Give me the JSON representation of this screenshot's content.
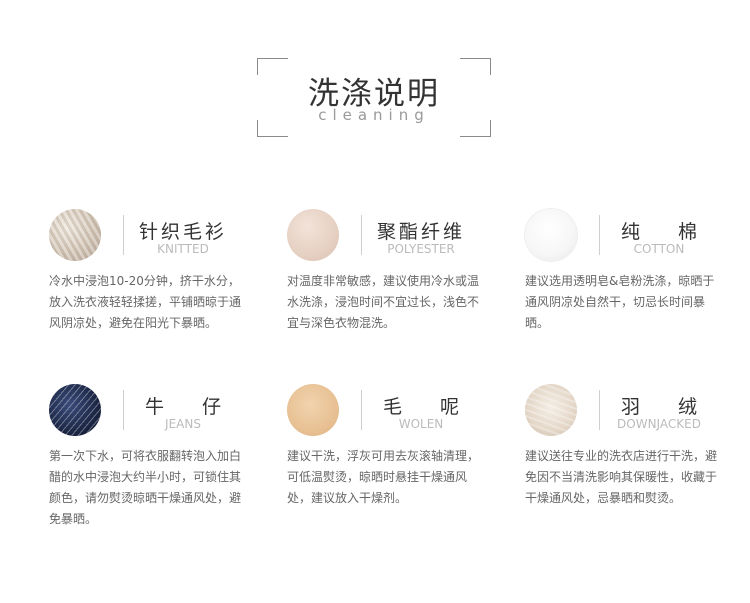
{
  "header": {
    "title": "洗涤说明",
    "subtitle": "cleaning"
  },
  "colors": {
    "title": "#333333",
    "text": "#666666",
    "english": "#bbbbbb",
    "corner": "#8a8a8a"
  },
  "fabrics": [
    {
      "name": "针织毛衫",
      "english": "KNITTED",
      "swatch": "knitted-swatch",
      "description": "冷水中浸泡10-20分钟，挤干水分，放入洗衣液轻轻揉搓，平铺晒晾于通风阴凉处，避免在阳光下暴晒。"
    },
    {
      "name": "聚酯纤维",
      "english": "POLYESTER",
      "swatch": "polyester-swatch",
      "description": "对温度非常敏感，建议使用冷水或温水洗涤，浸泡时间不宜过长，浅色不宜与深色衣物混洗。"
    },
    {
      "name": "纯　　棉",
      "english": "COTTON",
      "swatch": "cotton-swatch",
      "description": "建议选用透明皂&皂粉洗涤，晾晒于通风阴凉处自然干，切忌长时间暴晒。"
    },
    {
      "name": "牛　　仔",
      "english": "JEANS",
      "swatch": "jeans-swatch",
      "description": "第一次下水，可将衣服翻转泡入加白醋的水中浸泡大约半小时，可锁住其颜色，请勿熨烫晾晒干燥通风处，避免暴晒。"
    },
    {
      "name": "毛　　呢",
      "english": "WOLEN",
      "swatch": "wool-swatch",
      "description": "建议干洗，浮灰可用去灰滚轴清理，可低温熨烫，晾晒时悬挂干燥通风处，建议放入干燥剂。"
    },
    {
      "name": "羽　　绒",
      "english": "DOWNJACKED",
      "swatch": "down-swatch",
      "description": "建议送往专业的洗衣店进行干洗，避免因不当清洗影响其保暖性，收藏于干燥通风处，忌暴晒和熨烫。"
    }
  ]
}
